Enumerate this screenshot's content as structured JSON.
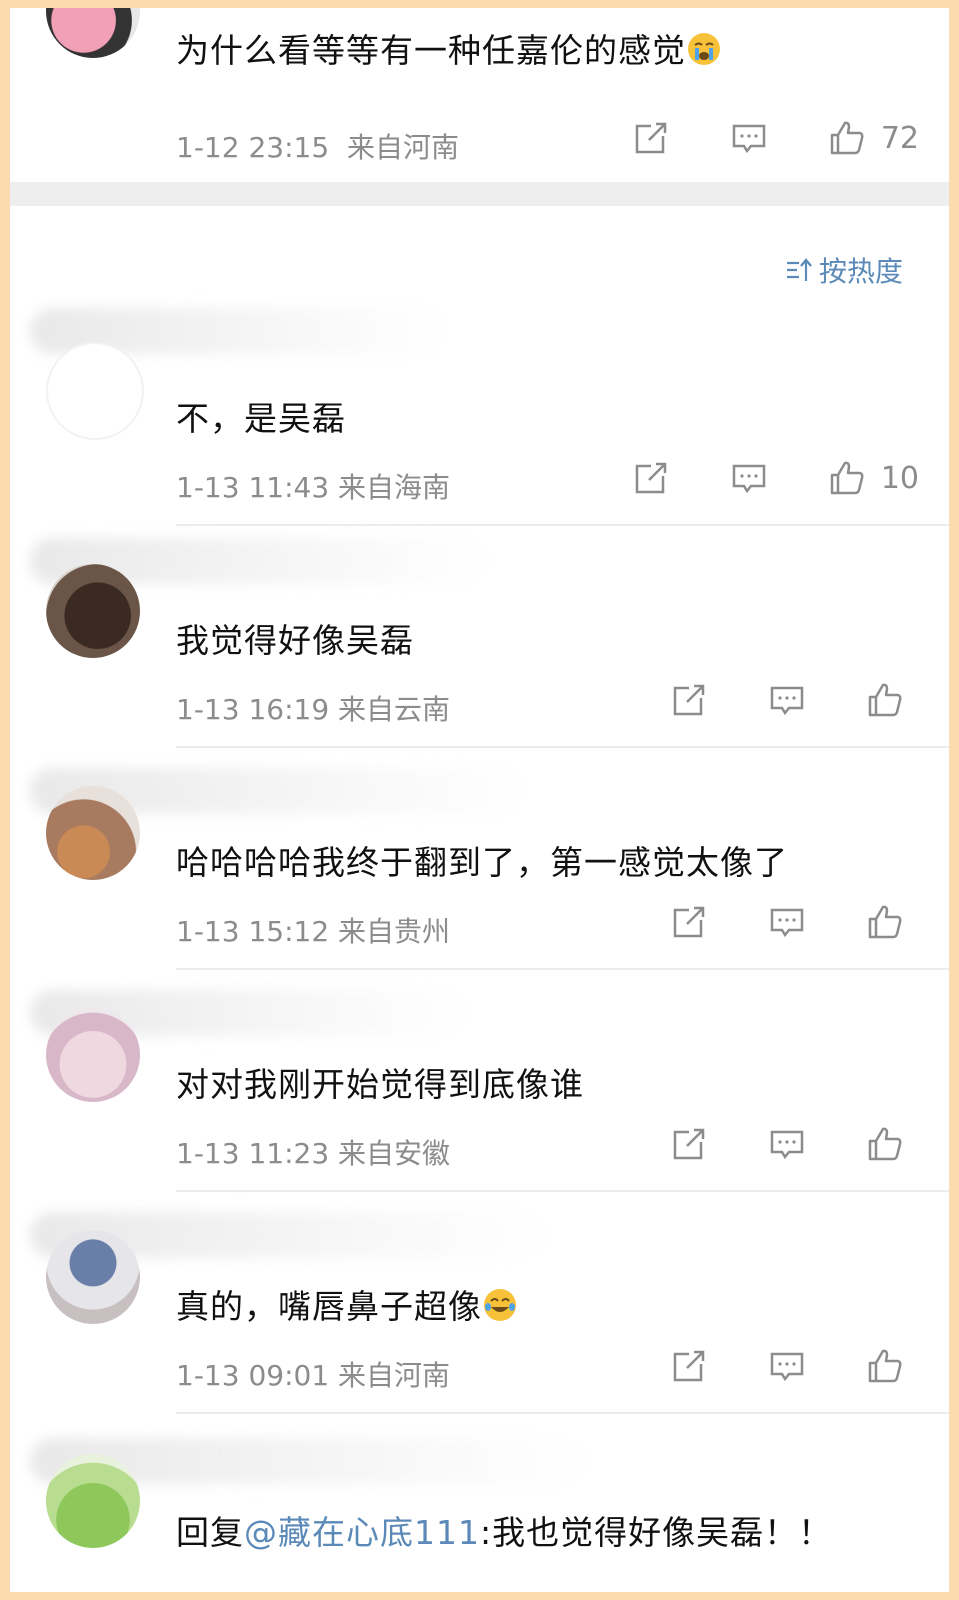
{
  "top_comment": {
    "text": "为什么看等等有一种任嘉伦的感觉",
    "emoji": "crying-face-emoji",
    "time": "1-12 23:15",
    "location": "来自河南",
    "likes": "72"
  },
  "sort_label": "按热度",
  "comments": [
    {
      "text": "不，是吴磊",
      "time": "1-13 11:43",
      "location": "来自海南",
      "likes": "10"
    },
    {
      "text": "我觉得好像吴磊",
      "time": "1-13 16:19",
      "location": "来自云南",
      "likes": ""
    },
    {
      "text": "哈哈哈哈我终于翻到了，第一感觉太像了",
      "time": "1-13 15:12",
      "location": "来自贵州",
      "likes": ""
    },
    {
      "text": "对对我刚开始觉得到底像谁",
      "time": "1-13 11:23",
      "location": "来自安徽",
      "likes": ""
    },
    {
      "text": "真的，嘴唇鼻子超像",
      "emoji": "laughing-tears-emoji",
      "time": "1-13 09:01",
      "location": "来自河南",
      "likes": ""
    }
  ],
  "last_reply": {
    "prefix": "回复",
    "mention": "@藏在心底111",
    "text": ":我也觉得好像吴磊！！"
  },
  "colors": {
    "accent": "#5b8ab8",
    "meta": "#8c8c8c",
    "border": "#fbdcb0"
  }
}
